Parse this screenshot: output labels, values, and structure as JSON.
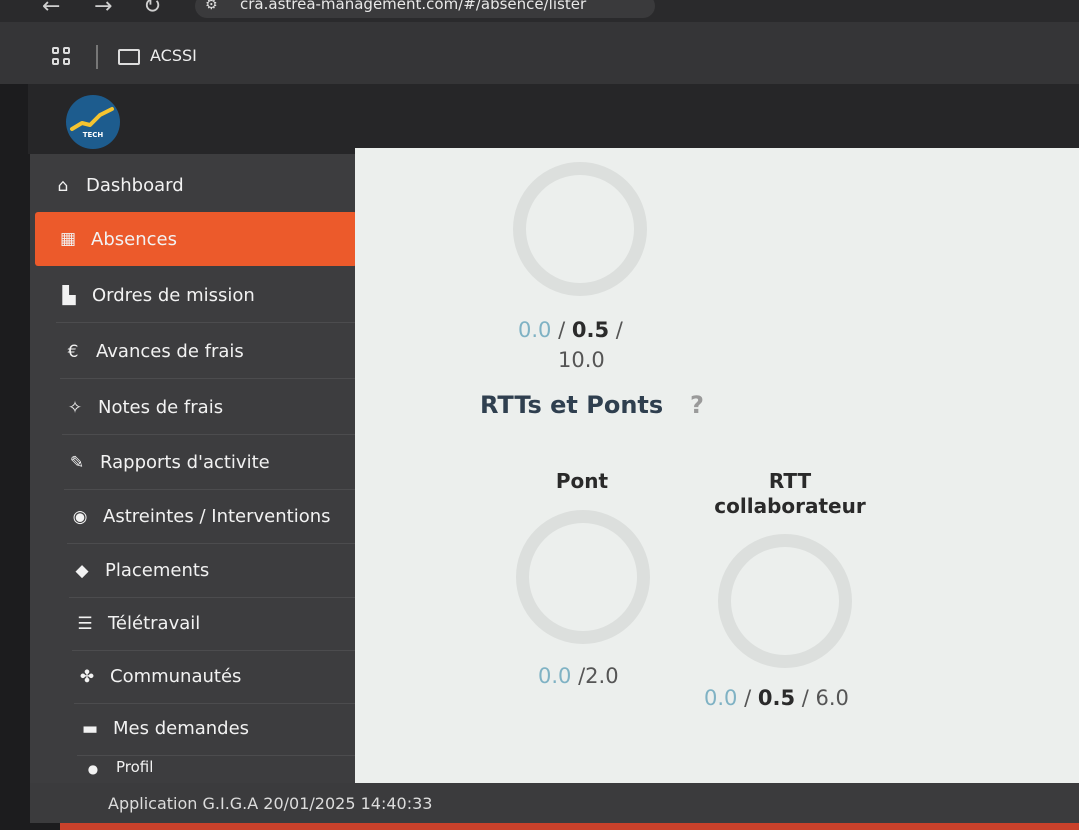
{
  "browser": {
    "url": "cra.astrea-management.com/#/absence/lister",
    "back_glyph": "←",
    "forward_glyph": "→",
    "reload_glyph": "↻",
    "bookmark_folder": "ACSSI"
  },
  "app": {
    "logo_text": "TECH"
  },
  "sidebar": {
    "items": [
      {
        "label": "Dashboard",
        "icon": "home-icon",
        "glyph": "⌂"
      },
      {
        "label": "Absences",
        "icon": "calendar-icon",
        "glyph": "▦"
      },
      {
        "label": "Ordres de mission",
        "icon": "document-icon",
        "glyph": "▙"
      },
      {
        "label": "Avances de frais",
        "icon": "euro-icon",
        "glyph": "€"
      },
      {
        "label": "Notes de frais",
        "icon": "pin-icon",
        "glyph": "✧"
      },
      {
        "label": "Rapports d'activite",
        "icon": "pencil-icon",
        "glyph": "✎"
      },
      {
        "label": "Astreintes / Interventions",
        "icon": "eye-icon",
        "glyph": "◉"
      },
      {
        "label": "Placements",
        "icon": "graduation-cap-icon",
        "glyph": "◆"
      },
      {
        "label": "Télétravail",
        "icon": "server-icon",
        "glyph": "☰"
      },
      {
        "label": "Communautés",
        "icon": "users-icon",
        "glyph": "✤"
      },
      {
        "label": "Mes demandes",
        "icon": "comment-icon",
        "glyph": "▬"
      },
      {
        "label": "Profil",
        "icon": "user-icon",
        "glyph": "●"
      }
    ]
  },
  "main": {
    "top_counter": {
      "taken": "0.0",
      "pending": "0.5",
      "total": "10.0"
    },
    "section_title": "RTTs et Ponts",
    "help_glyph": "?",
    "pont": {
      "title": "Pont",
      "taken": "0.0",
      "total": "2.0"
    },
    "rtt": {
      "title_line1": "RTT",
      "title_line2": "collaborateur",
      "taken": "0.0",
      "pending": "0.5",
      "total": "6.0"
    },
    "sep": "/"
  },
  "footer": {
    "text": "Application G.I.G.A 20/01/2025 14:40:33"
  },
  "colors": {
    "accent": "#ec5a2b",
    "sidebar_bg": "#3d3d3f",
    "panel_bg": "#ecefed",
    "counter_taken": "#7fb2c4",
    "title": "#2f3f4f"
  }
}
